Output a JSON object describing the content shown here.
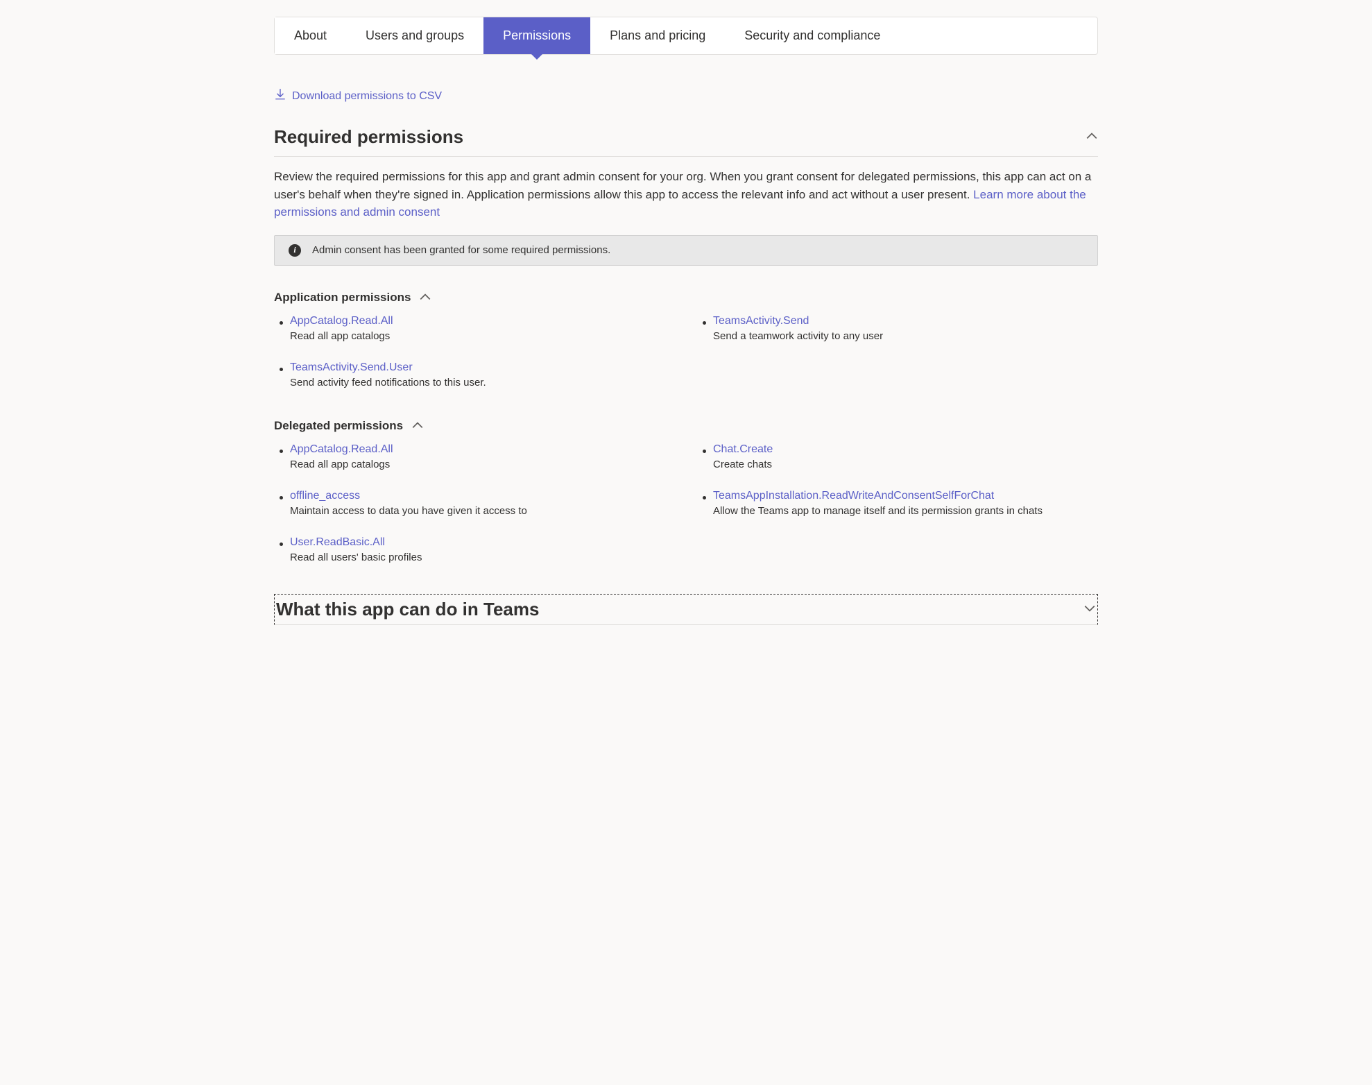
{
  "tabs": [
    {
      "label": "About",
      "active": false
    },
    {
      "label": "Users and groups",
      "active": false
    },
    {
      "label": "Permissions",
      "active": true
    },
    {
      "label": "Plans and pricing",
      "active": false
    },
    {
      "label": "Security and compliance",
      "active": false
    }
  ],
  "download_link": "Download permissions to CSV",
  "required_section": {
    "title": "Required permissions",
    "description_pre": "Review the required permissions for this app and grant admin consent for your org. When you grant consent for delegated permissions, this app can act on a user's behalf when they're signed in. Application permissions allow this app to access the relevant info and act without a user present. ",
    "description_link": "Learn more about the permissions and admin consent"
  },
  "info_banner": "Admin consent has been granted for some required permissions.",
  "app_perms": {
    "title": "Application permissions",
    "items": [
      {
        "name": "AppCatalog.Read.All",
        "desc": "Read all app catalogs"
      },
      {
        "name": "TeamsActivity.Send",
        "desc": "Send a teamwork activity to any user"
      },
      {
        "name": "TeamsActivity.Send.User",
        "desc": "Send activity feed notifications to this user."
      }
    ]
  },
  "delegated_perms": {
    "title": "Delegated permissions",
    "items": [
      {
        "name": "AppCatalog.Read.All",
        "desc": "Read all app catalogs"
      },
      {
        "name": "Chat.Create",
        "desc": "Create chats"
      },
      {
        "name": "offline_access",
        "desc": "Maintain access to data you have given it access to"
      },
      {
        "name": "TeamsAppInstallation.ReadWriteAndConsentSelfForChat",
        "desc": "Allow the Teams app to manage itself and its permission grants in chats"
      },
      {
        "name": "User.ReadBasic.All",
        "desc": "Read all users' basic profiles"
      }
    ]
  },
  "collapsed_section": {
    "title": "What this app can do in Teams"
  }
}
